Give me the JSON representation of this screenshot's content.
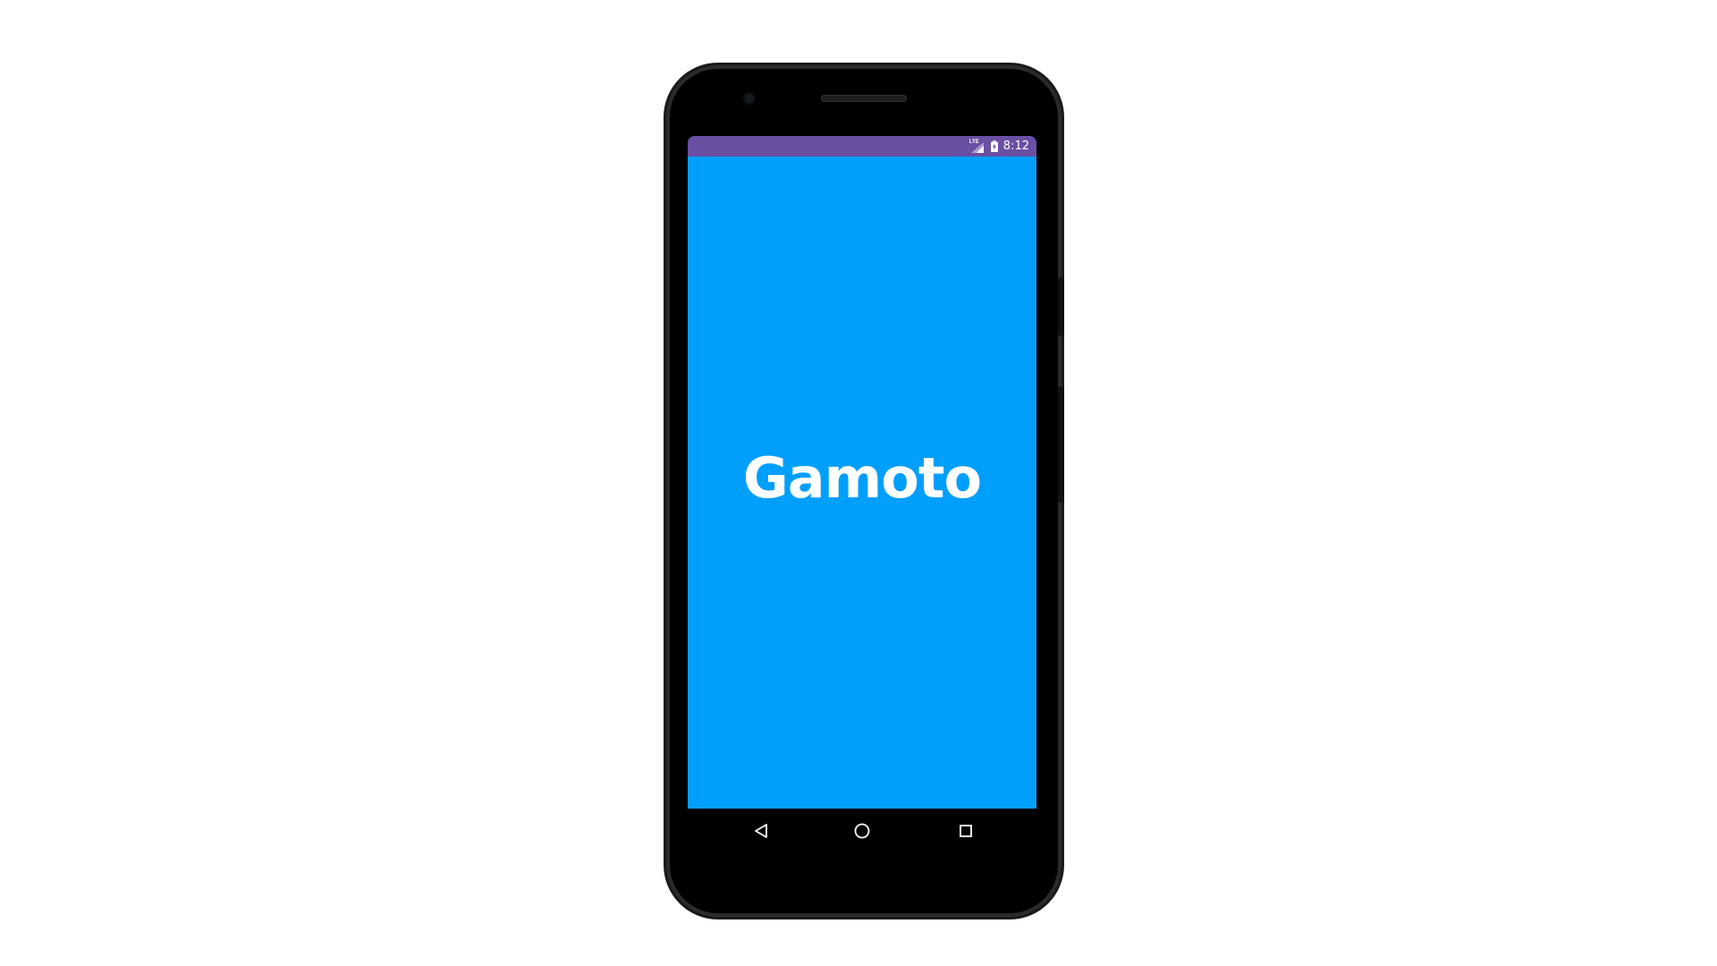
{
  "status_bar": {
    "network_label": "LTE",
    "time": "8:12",
    "color": "#6a4fa3"
  },
  "app": {
    "title": "Gamoto",
    "background_color": "#009ffc",
    "text_color": "#ffffff"
  },
  "navigation": {
    "buttons": [
      {
        "name": "back",
        "icon": "triangle-left-icon"
      },
      {
        "name": "home",
        "icon": "circle-icon"
      },
      {
        "name": "recents",
        "icon": "square-icon"
      }
    ]
  },
  "icons": {
    "camera": "front-camera-icon",
    "speaker": "earpiece-speaker-icon",
    "signal": "cellular-signal-icon",
    "battery": "battery-charging-icon"
  }
}
